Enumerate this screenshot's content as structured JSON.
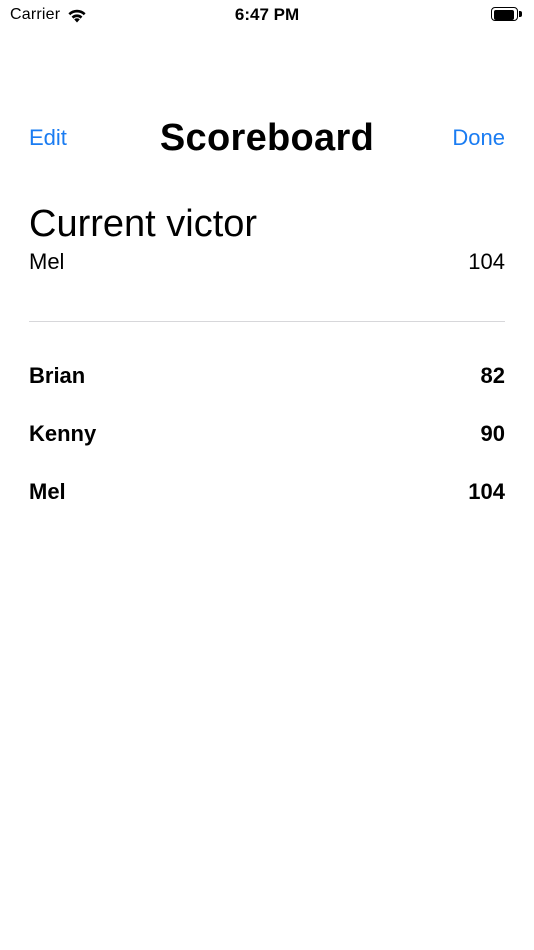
{
  "status_bar": {
    "carrier": "Carrier",
    "time": "6:47 PM",
    "battery_level_percent": 100,
    "icons": [
      "wifi-icon",
      "battery-icon"
    ]
  },
  "nav": {
    "edit_label": "Edit",
    "title": "Scoreboard",
    "done_label": "Done",
    "accent_color": "#1a7cf2"
  },
  "victor": {
    "heading": "Current victor",
    "name": "Mel",
    "score": "104"
  },
  "scores": [
    {
      "name": "Brian",
      "score": "82"
    },
    {
      "name": "Kenny",
      "score": "90"
    },
    {
      "name": "Mel",
      "score": "104"
    }
  ]
}
